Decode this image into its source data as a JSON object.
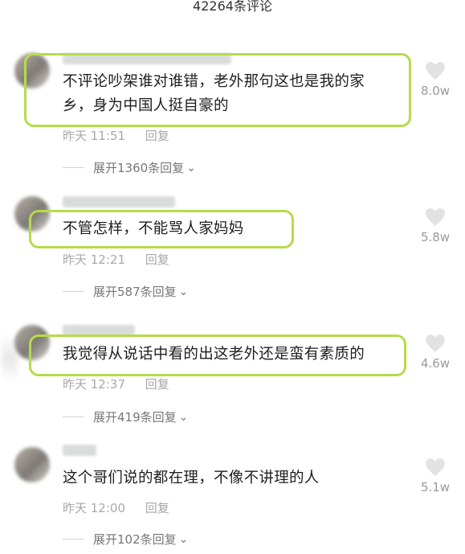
{
  "header": {
    "title": "42264条评论"
  },
  "comments": [
    {
      "text_lines": [
        "不评论吵架谁对谁错，老外那句这也是我的家",
        "乡，身为中国人挺自豪的"
      ],
      "time": "昨天 11:51",
      "reply_label": "回复",
      "expand_label": "展开1360条回复",
      "likes": "8.0w"
    },
    {
      "text_lines": [
        "不管怎样，不能骂人家妈妈"
      ],
      "time": "昨天 12:21",
      "reply_label": "回复",
      "expand_label": "展开587条回复",
      "likes": "5.8w"
    },
    {
      "text_lines": [
        "我觉得从说话中看的出这老外还是蛮有素质的"
      ],
      "time": "昨天 12:37",
      "reply_label": "回复",
      "expand_label": "展开419条回复",
      "likes": "4.6w"
    },
    {
      "text_lines": [
        "这个哥们说的都在理，不像不讲理的人"
      ],
      "time": "昨天 12:00",
      "reply_label": "回复",
      "expand_label": "展开102条回复",
      "likes": "5.1w"
    }
  ],
  "colors": {
    "highlight": "#b5dc4a",
    "meta": "#a8a8a8",
    "like_icon": "#e2e2e2"
  },
  "icons": {
    "like": "heart-icon",
    "expand": "chevron-down-icon"
  }
}
